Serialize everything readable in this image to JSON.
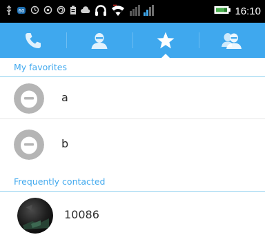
{
  "status_bar": {
    "time": "16:10",
    "icons": [
      "usb-icon",
      "notification-icon",
      "sync-icon",
      "alarm-icon",
      "circle-icon",
      "battery-saver-icon",
      "cloud-icon",
      "headset-icon",
      "wifi-icon",
      "signal-icon",
      "battery-icon"
    ]
  },
  "tabs": [
    {
      "name": "phone-icon",
      "selected": false
    },
    {
      "name": "contact-icon",
      "selected": false
    },
    {
      "name": "star-icon",
      "selected": true
    },
    {
      "name": "group-icon",
      "selected": false
    }
  ],
  "favorites": {
    "header": "My favorites",
    "items": [
      {
        "name": "a"
      },
      {
        "name": "b"
      }
    ]
  },
  "frequent": {
    "header": "Frequently contacted",
    "items": [
      {
        "name": "10086"
      }
    ]
  },
  "colors": {
    "accent": "#3fa8ee",
    "status_bar": "#000000",
    "avatar_gray": "#b5b5b5"
  }
}
